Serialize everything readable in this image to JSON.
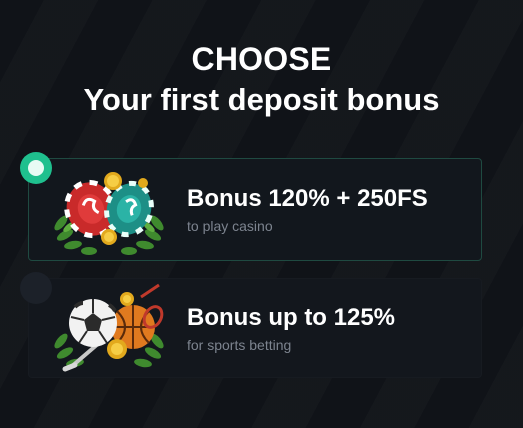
{
  "heading": {
    "line1": "CHOOSE",
    "line2": "Your first deposit bonus"
  },
  "options": [
    {
      "title": "Bonus 120% + 250FS",
      "subtitle": "to play casino",
      "selected": true,
      "icon": "casino-chips-icon"
    },
    {
      "title": "Bonus up to 125%",
      "subtitle": "for sports betting",
      "selected": false,
      "icon": "sports-balls-icon"
    }
  ],
  "colors": {
    "background": "#101318",
    "accent": "#1fc08e",
    "muted_text": "#7d848f"
  }
}
